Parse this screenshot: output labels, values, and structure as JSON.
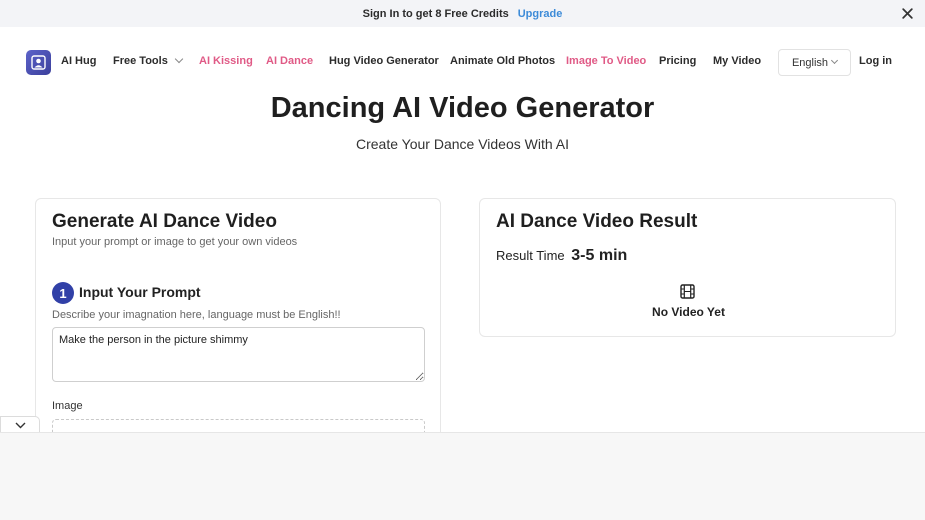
{
  "promo": {
    "text": "Sign In to get 8 Free Credits",
    "upgrade_label": "Upgrade",
    "close_icon": "close-icon"
  },
  "nav": {
    "brand": "AI Hug",
    "free_tools": "Free Tools",
    "ai_kissing": "AI Kissing",
    "ai_dance": "AI Dance",
    "hug_video_generator": "Hug Video Generator",
    "animate_old_photos": "Animate Old Photos",
    "image_to_video": "Image To Video",
    "pricing": "Pricing",
    "my_video": "My Video",
    "language": "English",
    "login": "Log in"
  },
  "hero": {
    "title": "Dancing AI Video Generator",
    "subtitle": "Create Your Dance Videos With AI"
  },
  "generate": {
    "title": "Generate AI Dance Video",
    "desc": "Input your prompt or image to get your own videos",
    "step_number": "1",
    "step_title": "Input Your Prompt",
    "step_desc": "Describe your imagnation here, language must be English!!",
    "prompt_value": "Make the person in the picture shimmy",
    "image_label": "Image"
  },
  "result": {
    "title": "AI Dance Video Result",
    "time_label": "Result Time",
    "time_value": "3-5 min",
    "empty_text": "No Video Yet"
  },
  "colors": {
    "accent_pink": "#e05a86",
    "accent_blue": "#3d8bd8",
    "step_badge": "#3140a7"
  }
}
